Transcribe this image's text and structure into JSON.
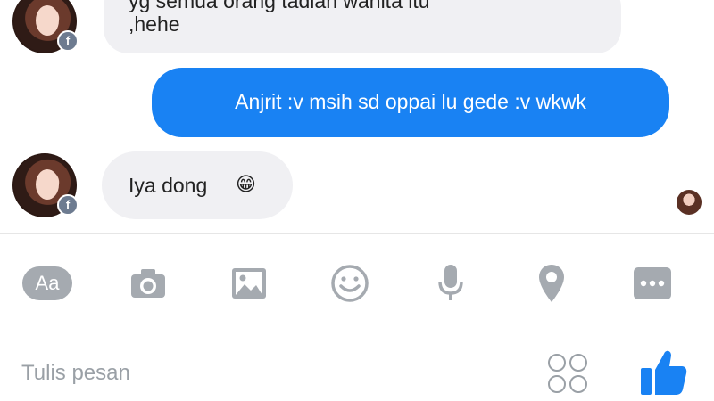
{
  "messages": [
    {
      "from": "other",
      "lines": [
        "yg semua orang tadian wanita itu",
        ",hehe"
      ]
    },
    {
      "from": "me",
      "text": "Anjrit :v msih sd oppai lu gede :v wkwk"
    },
    {
      "from": "other",
      "text": "Iya dong",
      "emoji": "😁"
    }
  ],
  "toolbar": {
    "aa_label": "Aa",
    "icons": [
      "aa-icon",
      "camera-icon",
      "gallery-icon",
      "smiley-icon",
      "mic-icon",
      "location-icon",
      "more-icon"
    ]
  },
  "composer": {
    "placeholder": "Tulis pesan",
    "sticker_icon": "sticker-grid-icon",
    "like_icon": "thumbs-up-icon"
  },
  "colors": {
    "accent": "#1982f3",
    "incoming_bubble": "#f0f0f3",
    "icon_gray": "#a5aab0"
  }
}
